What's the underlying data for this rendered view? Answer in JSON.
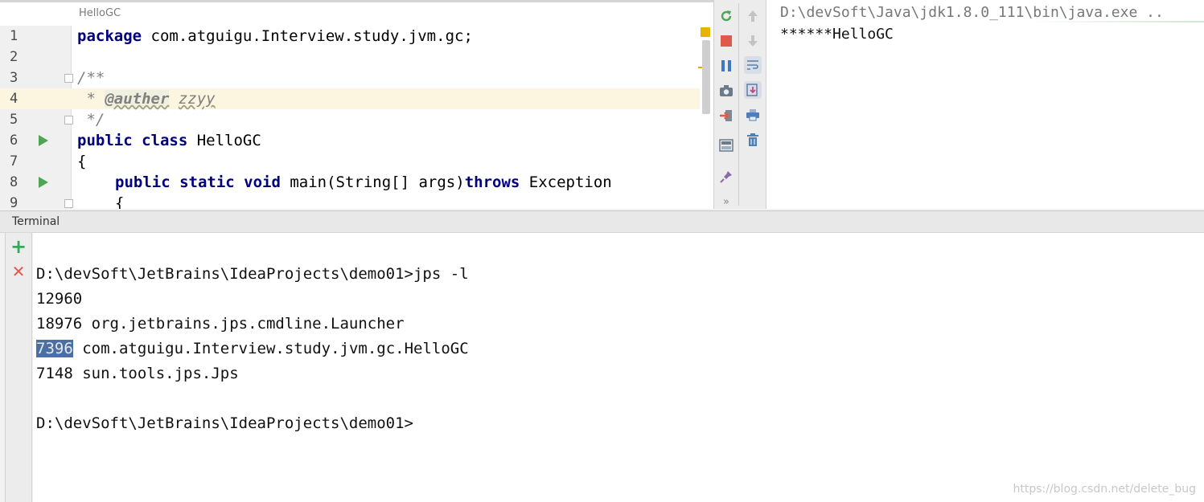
{
  "editor": {
    "tab_title": "HelloGC",
    "lines": [
      {
        "num": "1"
      },
      {
        "num": "2"
      },
      {
        "num": "3"
      },
      {
        "num": "4"
      },
      {
        "num": "5"
      },
      {
        "num": "6"
      },
      {
        "num": "7"
      },
      {
        "num": "8"
      },
      {
        "num": "9"
      }
    ],
    "code": {
      "l1_kw": "package",
      "l1_rest": " com.atguigu.Interview.study.jvm.gc;",
      "l3": "/**",
      "l4_star": " * ",
      "l4_tag": "@auther",
      "l4_name": "zzyy",
      "l5": " */",
      "l6_kw": "public class",
      "l6_rest": " HelloGC",
      "l7": "{",
      "l8_kw": "public static void",
      "l8_mid": " main(String[] args)",
      "l8_kw2": "throws",
      "l8_rest": " Exception",
      "l9": "{"
    }
  },
  "run": {
    "command": "D:\\devSoft\\Java\\jdk1.8.0_111\\bin\\java.exe ..",
    "output": "******HelloGC"
  },
  "terminal": {
    "title": "Terminal",
    "lines": [
      "D:\\devSoft\\JetBrains\\IdeaProjects\\demo01>jps -l",
      "12960",
      "18976 org.jetbrains.jps.cmdline.Launcher",
      "com.atguigu.Interview.study.jvm.gc.HelloGC",
      "7148 sun.tools.jps.Jps",
      "",
      "D:\\devSoft\\JetBrains\\IdeaProjects\\demo01>"
    ],
    "selected_pid": "7396"
  },
  "watermark": "https://blog.csdn.net/delete_bug",
  "colors": {
    "keyword": "#000080",
    "selection": "#4a6fa5",
    "run_green": "#4fa553",
    "stop_red": "#e05a4a"
  }
}
